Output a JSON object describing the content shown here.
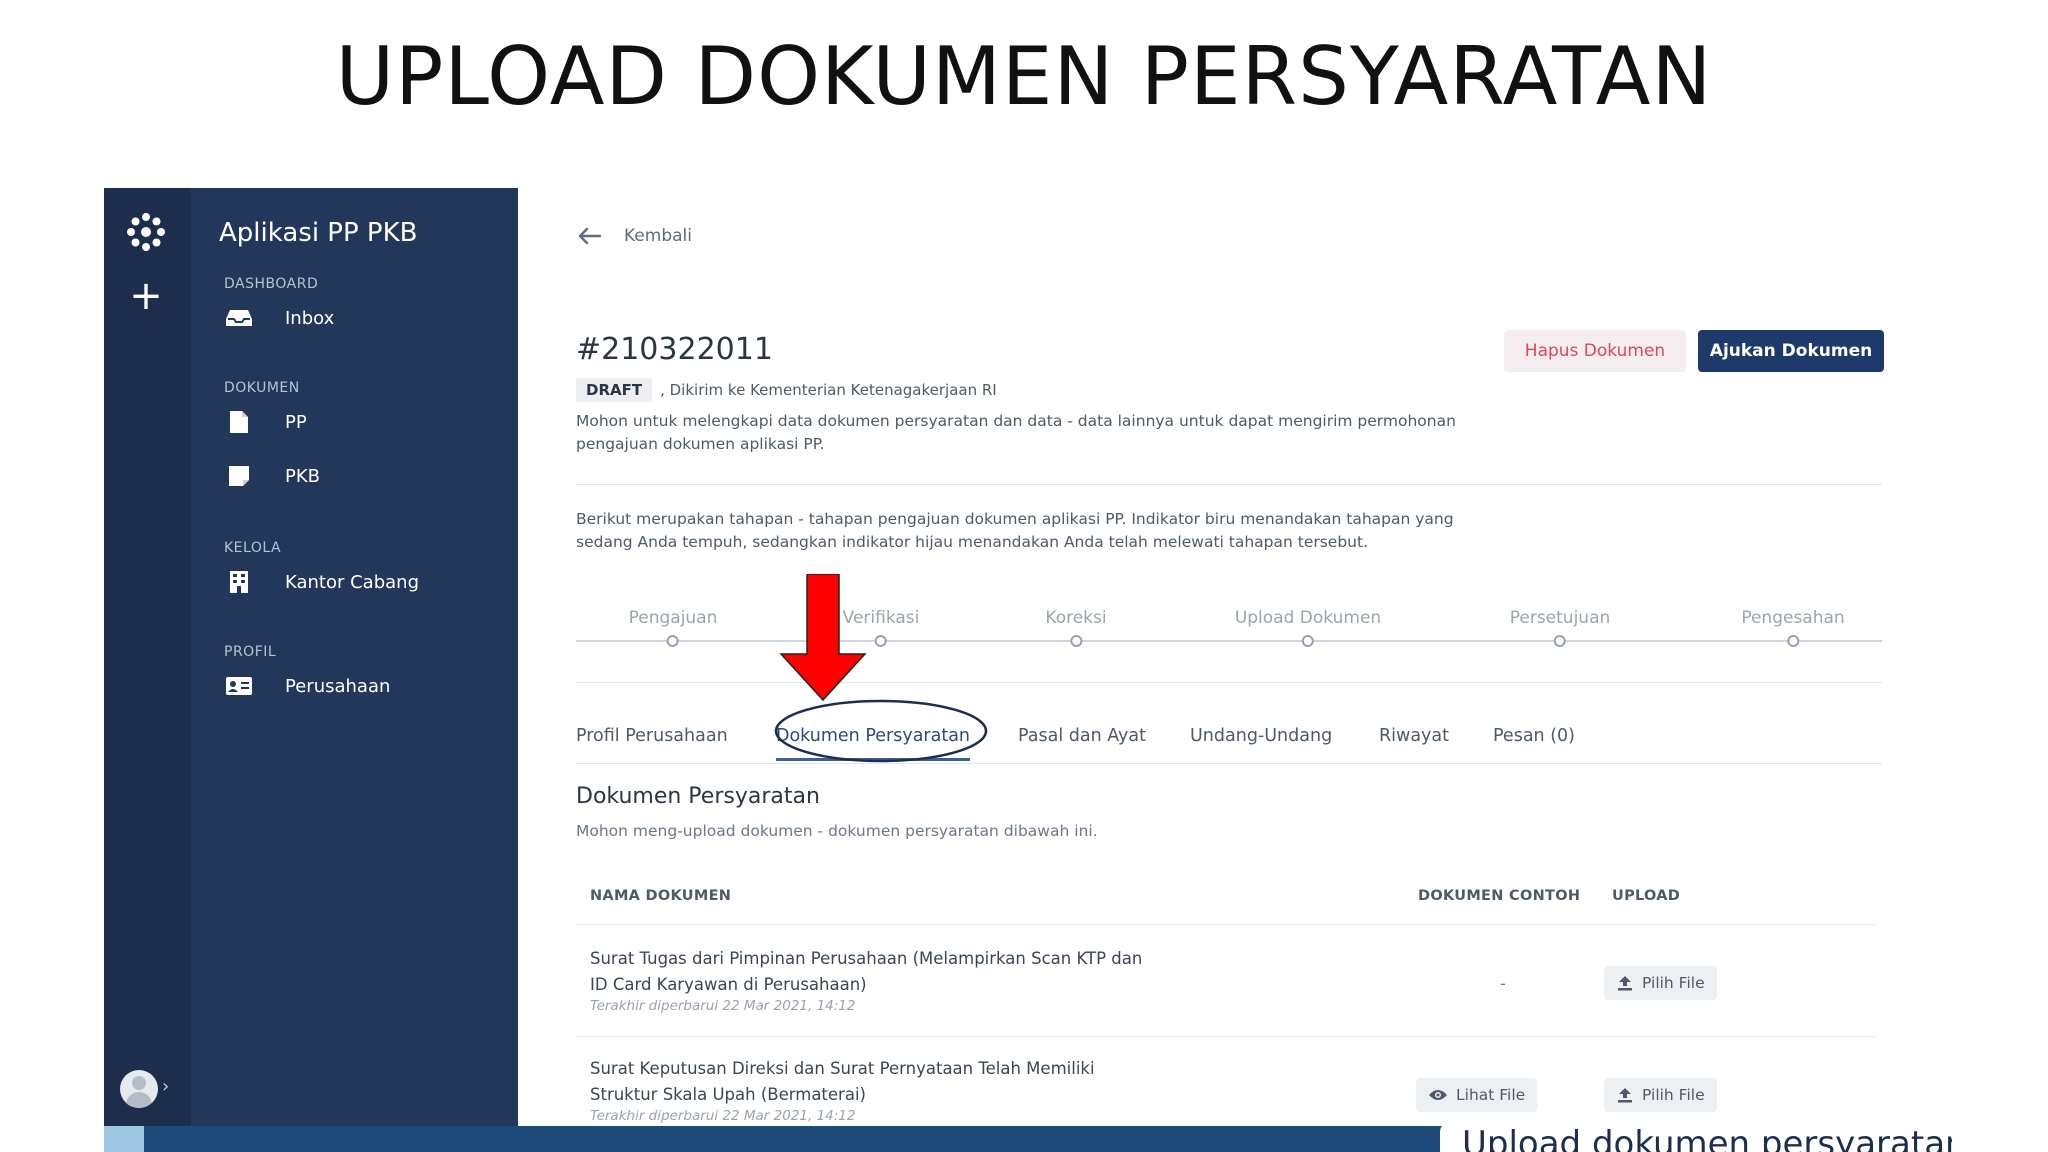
{
  "slide": {
    "title": "UPLOAD DOKUMEN PERSYARATAN",
    "caption": "Upload dokumen persyaratan"
  },
  "sidebar": {
    "app_name": "Aplikasi PP PKB",
    "sections": [
      {
        "title": "DASHBOARD",
        "items": [
          {
            "label": "Inbox",
            "icon": "inbox-icon"
          }
        ]
      },
      {
        "title": "DOKUMEN",
        "items": [
          {
            "label": "PP",
            "icon": "document-icon"
          },
          {
            "label": "PKB",
            "icon": "note-icon"
          }
        ]
      },
      {
        "title": "KELOLA",
        "items": [
          {
            "label": "Kantor Cabang",
            "icon": "building-icon"
          }
        ]
      },
      {
        "title": "PROFIL",
        "items": [
          {
            "label": "Perusahaan",
            "icon": "id-card-icon"
          }
        ]
      }
    ]
  },
  "header": {
    "back_label": "Kembali",
    "doc_id": "#210322011",
    "status_badge": "DRAFT",
    "status_text": ", Dikirim ke Kementerian Ketenagakerjaan RI",
    "intro": "Mohon untuk melengkapi data dokumen persyaratan dan data - data lainnya untuk dapat mengirim permohonan pengajuan dokumen aplikasi PP.",
    "delete_label": "Hapus Dokumen",
    "submit_label": "Ajukan Dokumen"
  },
  "stages": {
    "description": "Berikut merupakan tahapan - tahapan pengajuan dokumen aplikasi PP. Indikator biru menandakan tahapan yang sedang Anda tempuh, sedangkan indikator hijau menandakan Anda telah melewati tahapan tersebut.",
    "steps": [
      "Pengajuan",
      "Verifikasi",
      "Koreksi",
      "Upload Dokumen",
      "Persetujuan",
      "Pengesahan"
    ]
  },
  "tabs": [
    {
      "label": "Profil Perusahaan",
      "active": false
    },
    {
      "label": "Dokumen Persyaratan",
      "active": true
    },
    {
      "label": "Pasal dan Ayat",
      "active": false
    },
    {
      "label": "Undang-Undang",
      "active": false
    },
    {
      "label": "Riwayat",
      "active": false
    },
    {
      "label": "Pesan (0)",
      "active": false
    }
  ],
  "section": {
    "title": "Dokumen Persyaratan",
    "subtitle": "Mohon meng-upload dokumen - dokumen persyaratan dibawah ini."
  },
  "table": {
    "headers": [
      "NAMA DOKUMEN",
      "DOKUMEN CONTOH",
      "UPLOAD"
    ],
    "rows": [
      {
        "name": "Surat Tugas dari Pimpinan Perusahaan (Melampirkan Scan KTP dan ID Card Karyawan di Perusahaan)",
        "updated": "Terakhir diperbarui 22 Mar 2021, 14:12",
        "example": "-",
        "upload_label": "Pilih File"
      },
      {
        "name": "Surat Keputusan Direksi dan Surat Pernyataan Telah Memiliki Struktur Skala Upah (Bermaterai)",
        "updated": "Terakhir diperbarui 22 Mar 2021, 14:12",
        "example": "Lihat File",
        "upload_label": "Pilih File"
      }
    ]
  },
  "colors": {
    "rail": "#1d2e4d",
    "sidebar": "#22375a",
    "primary": "#1d3a6b",
    "danger": "#e0465b",
    "annotation": "#ff0000"
  }
}
